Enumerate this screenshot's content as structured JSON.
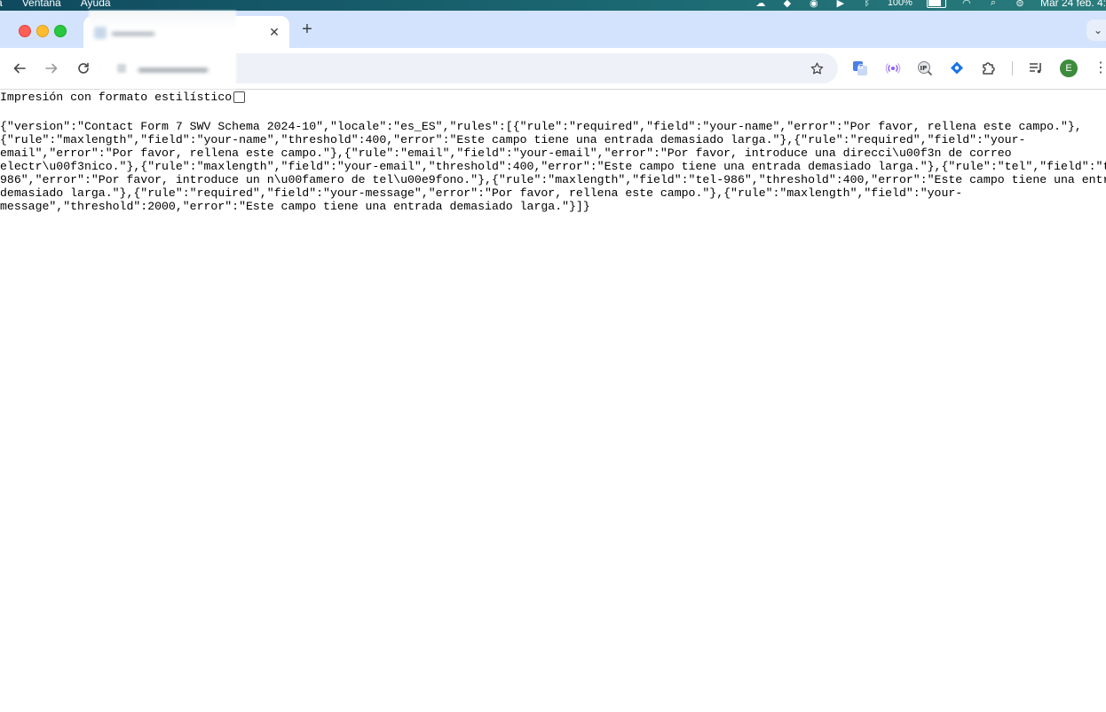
{
  "menubar": {
    "items": [
      "a",
      "Ventana",
      "Ayuda"
    ],
    "battery_percent": "100%",
    "datetime": "Mar 24 feb. 4:"
  },
  "browser": {
    "tab_close_glyph": "✕",
    "new_tab_glyph": "+",
    "tab_search_glyph": "⌄",
    "avatar_initial": "E",
    "battery_level": 0.9,
    "extensions": [
      "translate-icon",
      "broadcast-icon",
      "ip-icon",
      "tag-icon",
      "puzzle-icon",
      "media-control-icon"
    ]
  },
  "page": {
    "pretty_print_label": "Impresión con formato estilístico",
    "pretty_print_checked": false,
    "json_lines": [
      "{\"version\":\"Contact Form 7 SWV Schema 2024-10\",\"locale\":\"es_ES\",\"rules\":[{\"rule\":\"required\",\"field\":\"your-name\",\"error\":\"Por favor, rellena este campo.\"},",
      "{\"rule\":\"maxlength\",\"field\":\"your-name\",\"threshold\":400,\"error\":\"Este campo tiene una entrada demasiado larga.\"},{\"rule\":\"required\",\"field\":\"your-",
      "email\",\"error\":\"Por favor, rellena este campo.\"},{\"rule\":\"email\",\"field\":\"your-email\",\"error\":\"Por favor, introduce una direcci\\u00f3n de correo",
      "electr\\u00f3nico.\"},{\"rule\":\"maxlength\",\"field\":\"your-email\",\"threshold\":400,\"error\":\"Este campo tiene una entrada demasiado larga.\"},{\"rule\":\"tel\",\"field\":\"tel-",
      "986\",\"error\":\"Por favor, introduce un n\\u00famero de tel\\u00e9fono.\"},{\"rule\":\"maxlength\",\"field\":\"tel-986\",\"threshold\":400,\"error\":\"Este campo tiene una entrada",
      "demasiado larga.\"},{\"rule\":\"required\",\"field\":\"your-message\",\"error\":\"Por favor, rellena este campo.\"},{\"rule\":\"maxlength\",\"field\":\"your-",
      "message\",\"threshold\":2000,\"error\":\"Este campo tiene una entrada demasiado larga.\"}]}"
    ]
  }
}
